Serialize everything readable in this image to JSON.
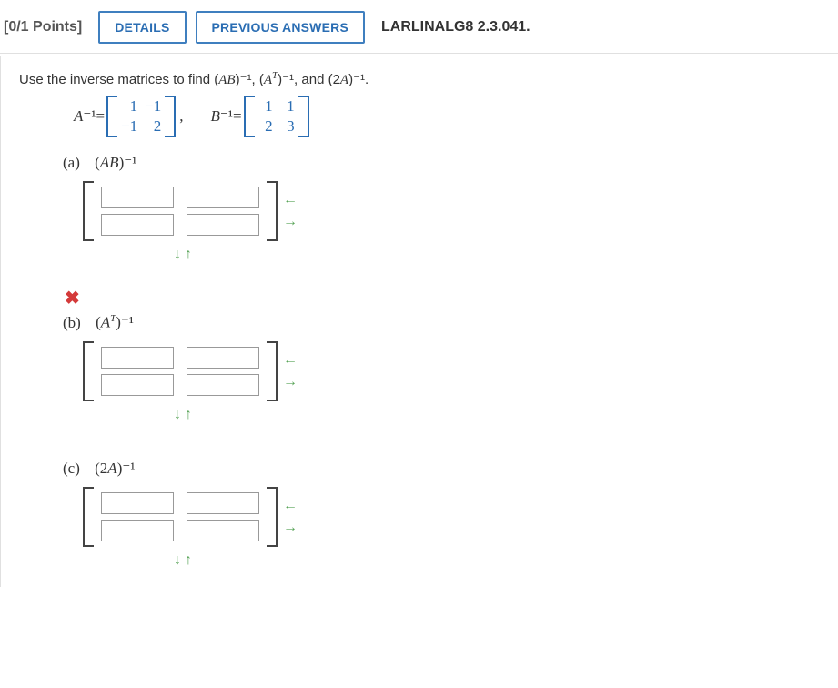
{
  "header": {
    "points": "[0/1 Points]",
    "details": "DETAILS",
    "previous": "PREVIOUS ANSWERS",
    "reference": "LARLINALG8 2.3.041."
  },
  "prompt_pre": "Use the inverse matrices to find (",
  "prompt_ab": "AB",
  "prompt_mid1": ")⁻¹, (",
  "prompt_at": "A",
  "prompt_tsup": "T",
  "prompt_mid2": ")⁻¹, and (2",
  "prompt_a": "A",
  "prompt_end": ")⁻¹.",
  "eq": {
    "a_label": "A",
    "a_exp": "⁻¹",
    "eq_sign": " = ",
    "a_mat": [
      "1",
      "−1",
      "−1",
      "2"
    ],
    "comma": ",",
    "b_label": "B",
    "b_exp": "⁻¹",
    "b_mat": [
      "1",
      "1",
      "2",
      "3"
    ]
  },
  "parts": {
    "a": {
      "tag": "(a)",
      "expr_pre": "(",
      "expr_var": "AB",
      "expr_post": ")⁻¹"
    },
    "b": {
      "tag": "(b)",
      "expr_pre": "(",
      "expr_var": "A",
      "expr_sup": "T",
      "expr_post": ")⁻¹"
    },
    "c": {
      "tag": "(c)",
      "expr_pre": "(2",
      "expr_var": "A",
      "expr_post": ")⁻¹"
    }
  },
  "arrows": {
    "left": "←",
    "right": "→",
    "down": "↓",
    "up": "↑"
  },
  "incorrect": "✖"
}
